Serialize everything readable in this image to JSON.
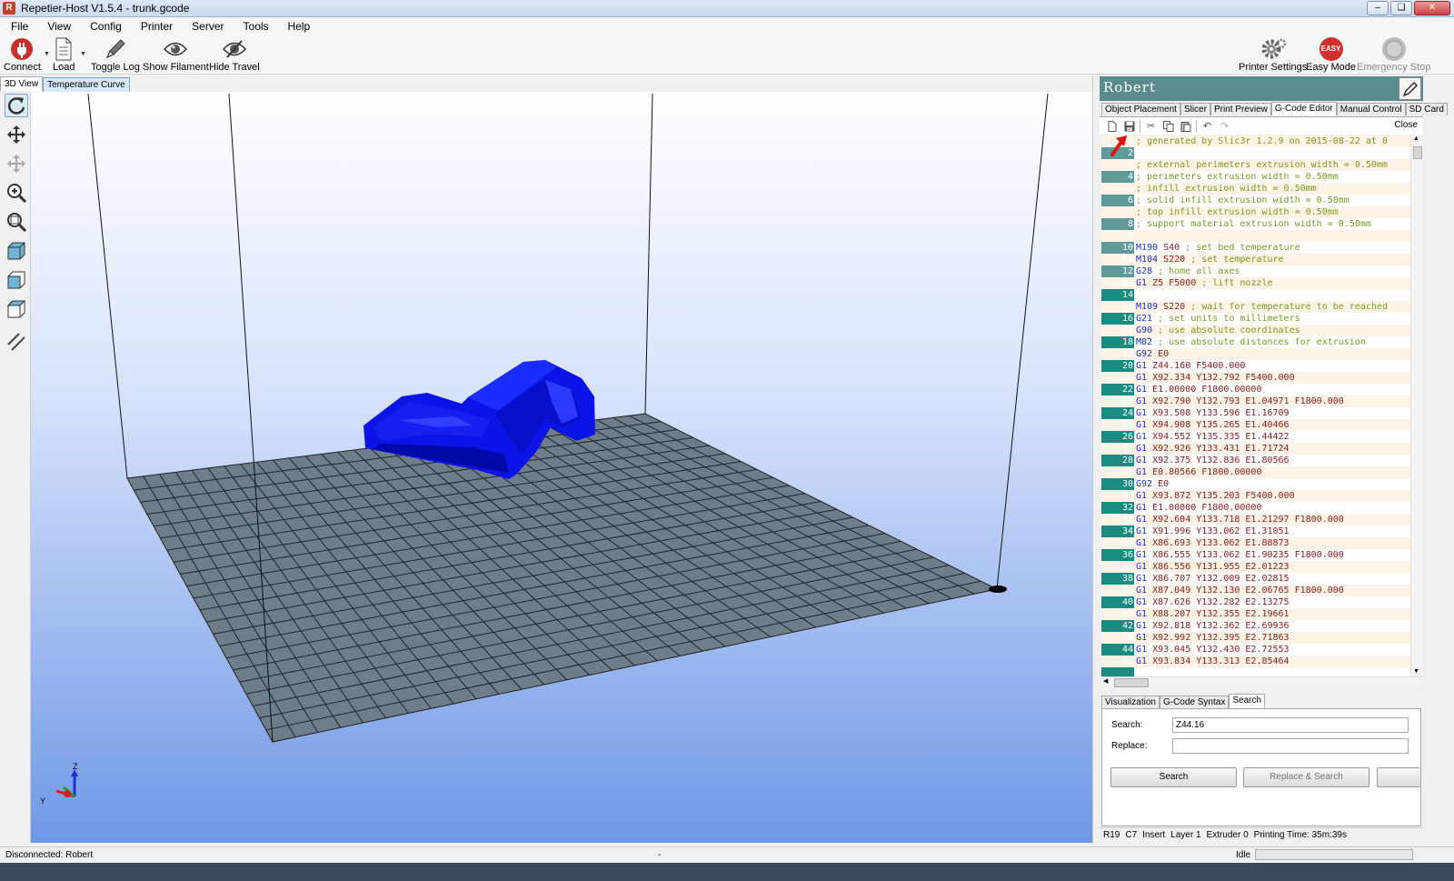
{
  "window": {
    "title": "Repetier-Host V1.5.4 - trunk.gcode",
    "app_icon": "R"
  },
  "menu": [
    "File",
    "View",
    "Config",
    "Printer",
    "Server",
    "Tools",
    "Help"
  ],
  "toolbar": {
    "connect": "Connect",
    "load": "Load",
    "toggle_log": "Toggle Log",
    "show_filament": "Show Filament",
    "hide_travel": "Hide Travel",
    "printer_settings": "Printer Settings",
    "easy_mode": "Easy Mode",
    "easy_badge": "EASY",
    "emergency_stop": "Emergency Stop"
  },
  "view_tabs": [
    "3D View",
    "Temperature Curve"
  ],
  "left_tools": [
    "rotate-icon",
    "move-icon",
    "move-object-icon",
    "zoom-icon",
    "fit-view-icon",
    "isometric-view-icon",
    "front-view-icon",
    "top-view-icon",
    "parallel-projection-icon"
  ],
  "right_panel": {
    "printer_name": "Robert",
    "tabs": [
      "Object Placement",
      "Slicer",
      "Print Preview",
      "G-Code Editor",
      "Manual Control",
      "SD Card"
    ],
    "active_tab": "G-Code Editor",
    "close_label": "Close"
  },
  "code_lines": [
    {
      "n": "1",
      "t": "; generated by Slic3r 1.2.9 on 2015-08-22 at 0",
      "k": "comment"
    },
    {
      "n": "2",
      "t": "",
      "k": "plain"
    },
    {
      "n": "3",
      "t": "; external perimeters extrusion width = 0.50mm",
      "k": "comment"
    },
    {
      "n": "4",
      "t": "; perimeters extrusion width = 0.50mm",
      "k": "comment"
    },
    {
      "n": "5",
      "t": "; infill extrusion width = 0.50mm",
      "k": "comment"
    },
    {
      "n": "6",
      "t": "; solid infill extrusion width = 0.50mm",
      "k": "comment"
    },
    {
      "n": "7",
      "t": "; top infill extrusion width = 0.50mm",
      "k": "comment"
    },
    {
      "n": "8",
      "t": "; support material extrusion width = 0.50mm",
      "k": "comment"
    },
    {
      "n": "9",
      "t": "",
      "k": "plain"
    },
    {
      "n": "10",
      "c": "M190",
      "a": " S40",
      "r": " ; set bed temperature",
      "k": "cmd"
    },
    {
      "n": "11",
      "c": "M104",
      "a": " S220",
      "r": " ; set temperature",
      "k": "cmd"
    },
    {
      "n": "12",
      "c": "G28",
      "a": "",
      "r": " ; home all axes",
      "k": "cmd"
    },
    {
      "n": "13",
      "c": "G1",
      "a": " Z5 F5000",
      "r": " ; lift nozzle",
      "k": "cmd"
    },
    {
      "n": "14",
      "t": "",
      "k": "plain"
    },
    {
      "n": "15",
      "c": "M109",
      "a": " S220",
      "r": " ; wait for temperature to be reached",
      "k": "cmd"
    },
    {
      "n": "16",
      "c": "G21",
      "a": "",
      "r": " ; set units to millimeters",
      "k": "cmd"
    },
    {
      "n": "17",
      "c": "G90",
      "a": "",
      "r": " ; use absolute coordinates",
      "k": "cmd"
    },
    {
      "n": "18",
      "c": "M82",
      "a": "",
      "r": " ; use absolute distances for extrusion",
      "k": "cmd"
    },
    {
      "n": "19",
      "c": "G92",
      "a": " E0",
      "r": "",
      "k": "cmd"
    },
    {
      "n": "20",
      "c": "G1",
      "a": " Z44.160 F5400.000",
      "r": "",
      "k": "cmd"
    },
    {
      "n": "21",
      "c": "G1",
      "a": " X92.334 Y132.792 F5400.000",
      "r": "",
      "k": "cmd"
    },
    {
      "n": "22",
      "c": "G1",
      "a": " E1.00000 F1800.00000",
      "r": "",
      "k": "cmd"
    },
    {
      "n": "23",
      "c": "G1",
      "a": " X92.790 Y132.793 E1.04971 F1800.000",
      "r": "",
      "k": "cmd"
    },
    {
      "n": "24",
      "c": "G1",
      "a": " X93.508 Y133.596 E1.16709",
      "r": "",
      "k": "cmd"
    },
    {
      "n": "25",
      "c": "G1",
      "a": " X94.908 Y135.265 E1.40466",
      "r": "",
      "k": "cmd"
    },
    {
      "n": "26",
      "c": "G1",
      "a": " X94.552 Y135.335 E1.44422",
      "r": "",
      "k": "cmd"
    },
    {
      "n": "27",
      "c": "G1",
      "a": " X92.926 Y133.431 E1.71724",
      "r": "",
      "k": "cmd"
    },
    {
      "n": "28",
      "c": "G1",
      "a": " X92.375 Y132.836 E1.80566",
      "r": "",
      "k": "cmd"
    },
    {
      "n": "29",
      "c": "G1",
      "a": " E0.80566 F1800.00000",
      "r": "",
      "k": "cmd"
    },
    {
      "n": "30",
      "c": "G92",
      "a": " E0",
      "r": "",
      "k": "cmd"
    },
    {
      "n": "31",
      "c": "G1",
      "a": " X93.872 Y135.203 F5400.000",
      "r": "",
      "k": "cmd"
    },
    {
      "n": "32",
      "c": "G1",
      "a": " E1.00000 F1800.00000",
      "r": "",
      "k": "cmd"
    },
    {
      "n": "33",
      "c": "G1",
      "a": " X92.604 Y133.718 E1.21297 F1800.000",
      "r": "",
      "k": "cmd"
    },
    {
      "n": "34",
      "c": "G1",
      "a": " X91.996 Y133.062 E1.31051",
      "r": "",
      "k": "cmd"
    },
    {
      "n": "35",
      "c": "G1",
      "a": " X86.693 Y133.062 E1.88873",
      "r": "",
      "k": "cmd"
    },
    {
      "n": "36",
      "c": "G1",
      "a": " X86.555 Y133.062 E1.90235 F1800.000",
      "r": "",
      "k": "cmd"
    },
    {
      "n": "37",
      "c": "G1",
      "a": " X86.556 Y131.955 E2.01223",
      "r": "",
      "k": "cmd"
    },
    {
      "n": "38",
      "c": "G1",
      "a": " X86.707 Y132.009 E2.02815",
      "r": "",
      "k": "cmd"
    },
    {
      "n": "39",
      "c": "G1",
      "a": " X87.049 Y132.130 E2.06765 F1800.000",
      "r": "",
      "k": "cmd"
    },
    {
      "n": "40",
      "c": "G1",
      "a": " X87.626 Y132.282 E2.13275",
      "r": "",
      "k": "cmd"
    },
    {
      "n": "41",
      "c": "G1",
      "a": " X88.207 Y132.355 E2.19661",
      "r": "",
      "k": "cmd"
    },
    {
      "n": "42",
      "c": "G1",
      "a": " X92.818 Y132.362 E2.69936",
      "r": "",
      "k": "cmd"
    },
    {
      "n": "43",
      "c": "G1",
      "a": " X92.992 Y132.395 E2.71863",
      "r": "",
      "k": "cmd"
    },
    {
      "n": "44",
      "c": "G1",
      "a": " X93.045 Y132.430 E2.72553",
      "r": "",
      "k": "cmd"
    },
    {
      "n": "45",
      "c": "G1",
      "a": " X93.834 Y133.313 E2.85464",
      "r": "",
      "k": "cmd"
    }
  ],
  "bottom_tabs": [
    "Visualization",
    "G-Code Syntax",
    "Search"
  ],
  "search": {
    "search_label": "Search:",
    "search_value": "Z44.16",
    "replace_label": "Replace:",
    "replace_value": "",
    "search_button": "Search",
    "replace_search_button": "Replace & Search"
  },
  "editor_status": [
    "R19",
    "C7",
    "Insert",
    "Layer 1",
    "Extruder 0",
    "Printing Time: 35m:39s"
  ],
  "statusbar": {
    "connection": "Disconnected: Robert",
    "middle": "-",
    "state": "Idle"
  },
  "axis_labels": {
    "z": "Z",
    "y": "Y"
  },
  "colors": {
    "accent": "#5b8c8d",
    "model": "#0a14e6",
    "bed": "#6d7d8a",
    "gutter": "#1a8b80"
  }
}
